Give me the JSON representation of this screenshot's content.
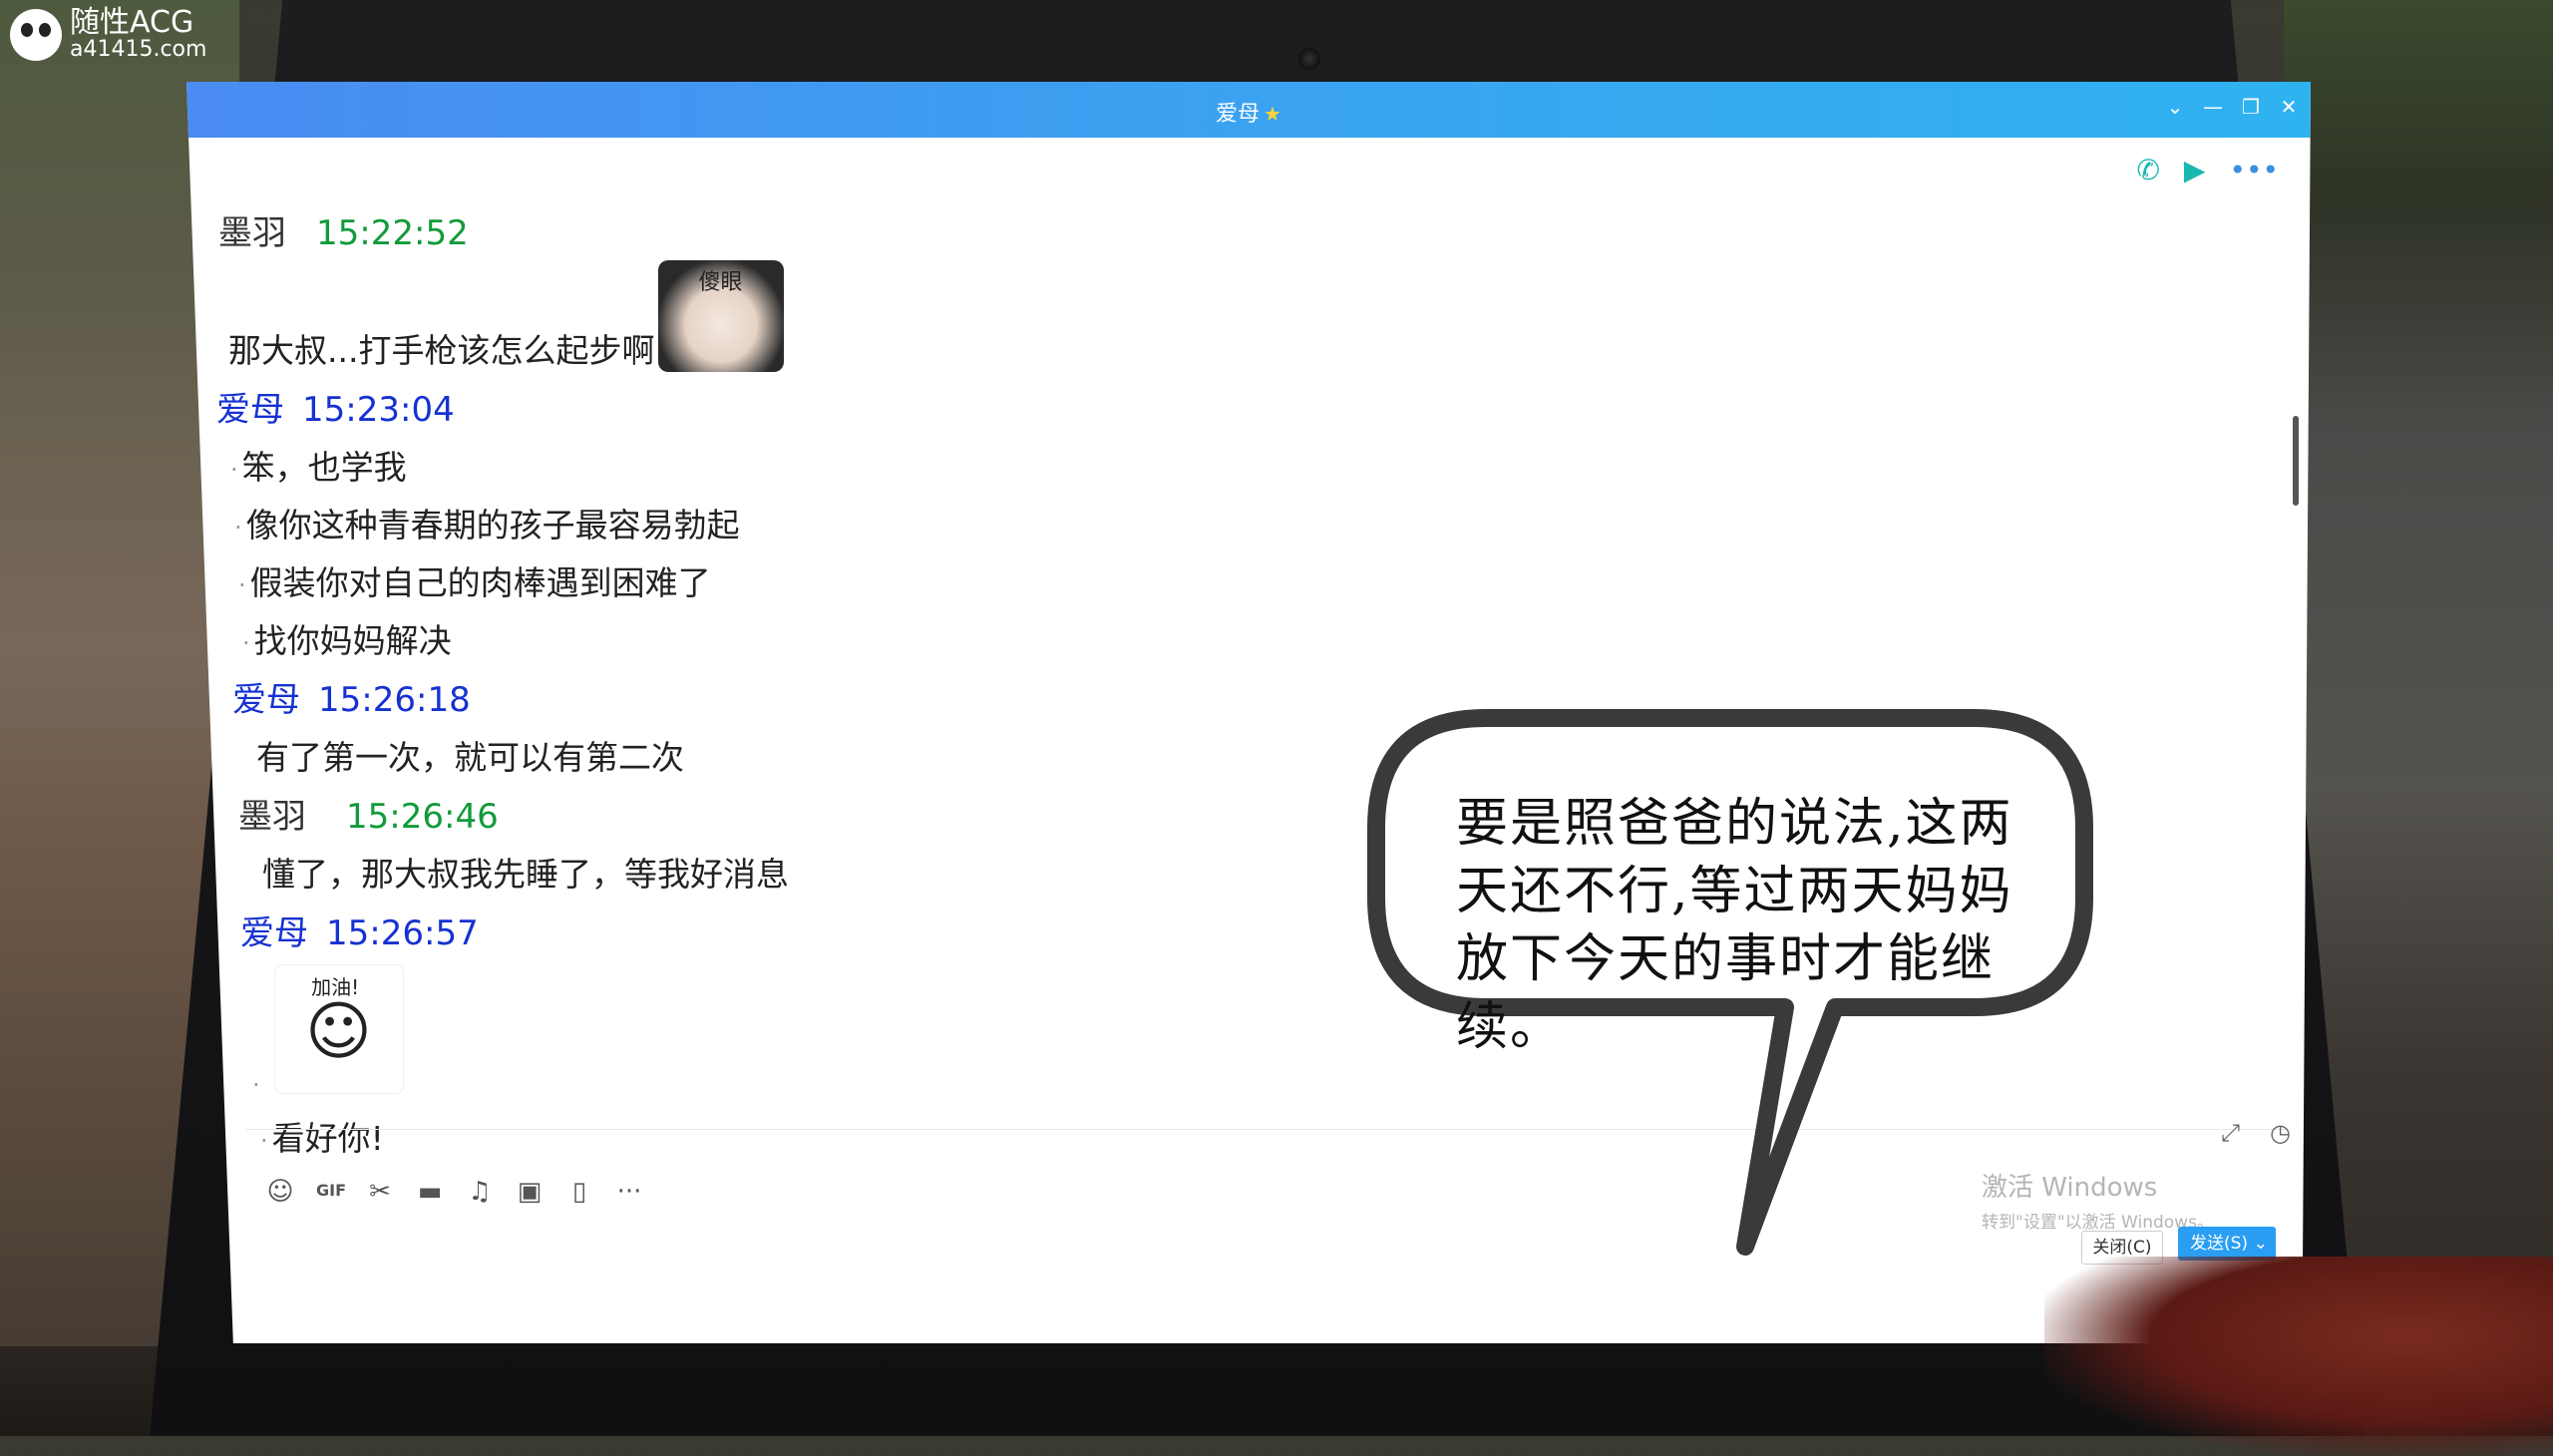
{
  "watermark": {
    "line1": "随性ACG",
    "line2": "a41415.com"
  },
  "window": {
    "title": "爱母",
    "controls": [
      "⌄",
      "—",
      "❐",
      "✕"
    ]
  },
  "call_icons": [
    "phone-icon",
    "video-icon",
    "more-icon"
  ],
  "messages": [
    {
      "name": "墨羽",
      "time": "15:22:52",
      "self": true,
      "lines": [
        "那大叔...打手枪该怎么起步啊"
      ],
      "sticker": "傻眼"
    },
    {
      "name": "爱母",
      "time": "15:23:04",
      "self": false,
      "lines": [
        "笨，也学我",
        "像你这种青春期的孩子最容易勃起",
        "假装你对自己的肉棒遇到困难了",
        "找你妈妈解决"
      ]
    },
    {
      "name": "爱母",
      "time": "15:26:18",
      "self": false,
      "lines": [
        "有了第一次，就可以有第二次"
      ]
    },
    {
      "name": "墨羽",
      "time": "15:26:46",
      "self": true,
      "lines": [
        "懂了，那大叔我先睡了，等我好消息"
      ]
    },
    {
      "name": "爱母",
      "time": "15:26:57",
      "self": false,
      "sticker": "加油!",
      "lines": [
        "看好你!"
      ]
    }
  ],
  "toolbar_icons": [
    "emoji-icon",
    "gif-icon",
    "scissors-icon",
    "folder-icon",
    "music-icon",
    "image-icon",
    "shake-icon",
    "more-icon"
  ],
  "activate": {
    "line1": "激活 Windows",
    "line2": "转到\"设置\"以激活 Windows。"
  },
  "buttons": {
    "close": "关闭(C)",
    "send": "发送(S)"
  },
  "speech_bubble": {
    "text": "要是照爸爸的说法,这两天还不行,等过两天妈妈放下今天的事时才能继续。"
  }
}
